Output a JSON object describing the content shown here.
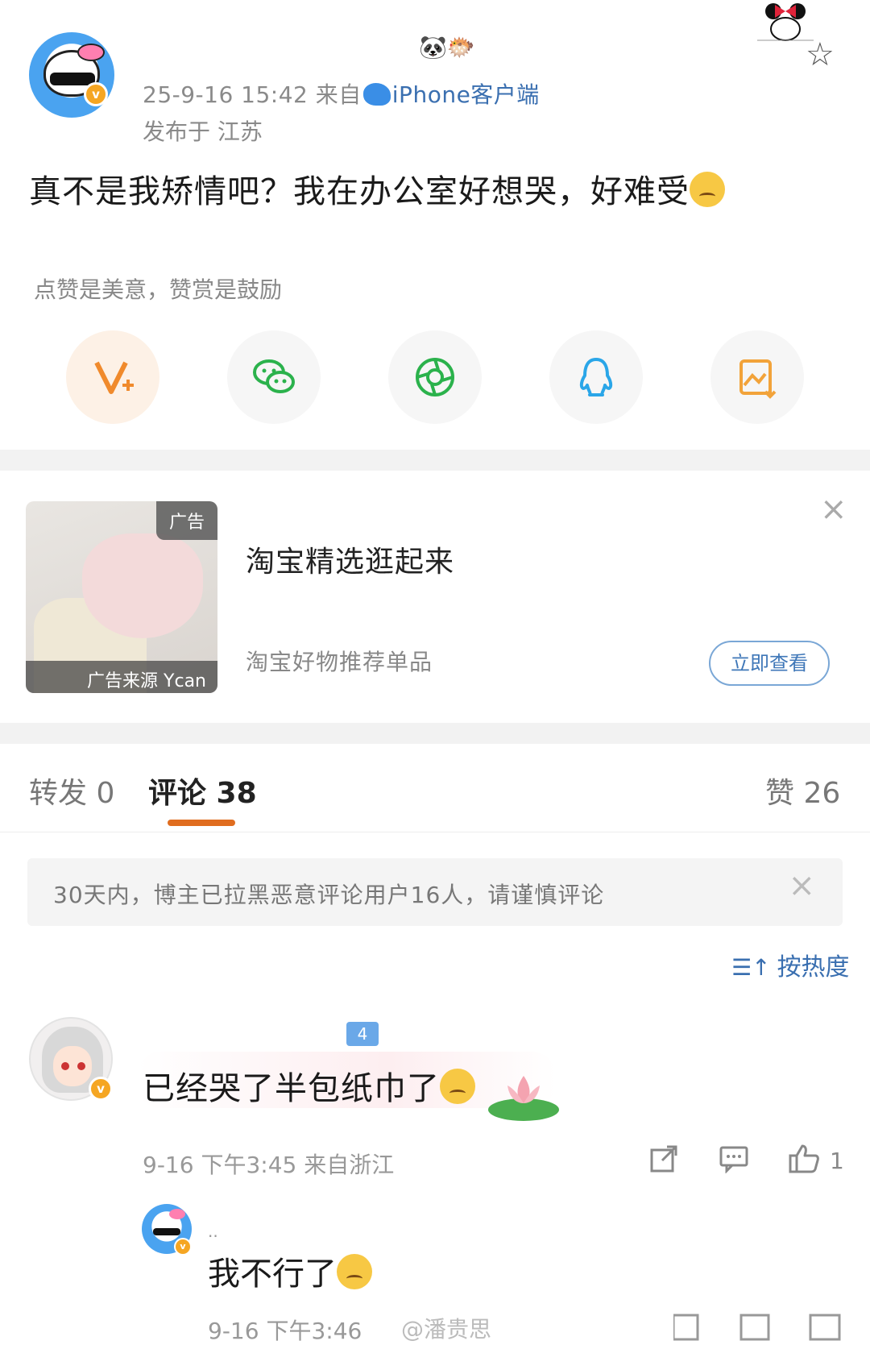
{
  "post": {
    "time_prefix": "25-9-16 15:42  来自",
    "client": "iPhone客户端",
    "location": "发布于 江苏",
    "text": "真不是我矫情吧？我在办公室好想哭，好难受",
    "verified_mark": "v"
  },
  "reward": {
    "hint": "点赞是美意，赞赏是鼓励",
    "share_icons": [
      "vplus-icon",
      "wechat-icon",
      "moments-icon",
      "qq-icon",
      "save-image-icon"
    ]
  },
  "ad": {
    "tag": "广告",
    "source": "广告来源 Ycan",
    "title": "淘宝精选逛起来",
    "subtitle": "淘宝好物推荐单品",
    "button": "立即查看"
  },
  "tabs": {
    "repost": "转发 0",
    "comments": "评论 38",
    "likes": "赞 26"
  },
  "notice": {
    "text": "30天内，博主已拉黑恶意评论用户16人，请谨慎评论"
  },
  "sort": {
    "label": "按热度"
  },
  "comments": [
    {
      "fan_level": "4",
      "text": "已经哭了半包纸巾了",
      "meta": "9-16 下午3:45  来自浙江",
      "likes": "1",
      "reply": {
        "name": "..",
        "text": "我不行了",
        "meta": "9-16 下午3:46"
      }
    }
  ],
  "watermark": "@潘贵思",
  "colors": {
    "accent_orange": "#e06d1f",
    "link_blue": "#3a6fb0",
    "verified": "#f5a623",
    "wechat_green": "#2bb24c",
    "qq_blue": "#2aa6e8"
  }
}
